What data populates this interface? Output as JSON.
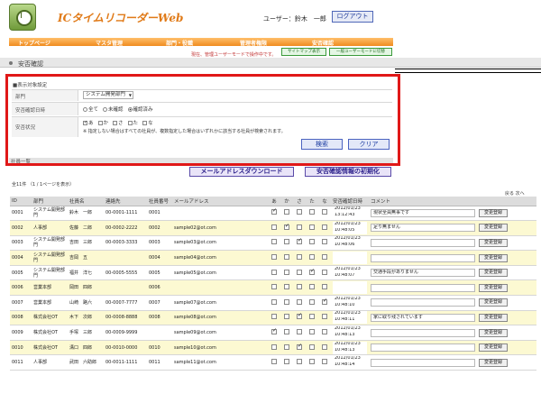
{
  "header": {
    "app_title": "ICタイムリコーダーWeb",
    "user_label": "ユーザー：鈴木　一郎",
    "logout": "ログアウト"
  },
  "nav": {
    "items": [
      "トップページ",
      "マスタ管理",
      "部門・役職",
      "管理者権限",
      "安否確認"
    ],
    "note": "現在、管理ユーザーモードで操作中です。",
    "sitemap_button": "サイトマップ表示",
    "user_mode_button": "一般ユーザーモードに切替"
  },
  "breadcrumb": "安否確認",
  "filter": {
    "title": "■表示対象設定",
    "dept_label": "部門",
    "dept_value": "システム開発部門",
    "reply_label": "安否確認日時",
    "reply_options": [
      {
        "label": "全て",
        "on": false
      },
      {
        "label": "未確認",
        "on": false
      },
      {
        "label": "確認済み",
        "on": true
      }
    ],
    "status_label": "安否状況",
    "status_options": [
      {
        "label": "あ",
        "on": true
      },
      {
        "label": "か",
        "on": false
      },
      {
        "label": "さ",
        "on": false
      },
      {
        "label": "た",
        "on": false
      },
      {
        "label": "な",
        "on": false
      }
    ],
    "note": "※ 指定しない場合はすべての社員が、複数指定した場合はいずれかに該当する社員が検索されます。",
    "search_button": "検索",
    "clear_button": "クリア"
  },
  "section_title": "社員一覧",
  "actions": {
    "download": "メールアドレスダウンロード",
    "reset": "安否確認情報の初期化"
  },
  "count_text": "全11件 （1 / 1ページを表示）",
  "pager": "戻る 次へ",
  "table": {
    "headers": [
      "ID",
      "部門",
      "社員名",
      "連絡先",
      "社員番号",
      "メールアドレス",
      "あ",
      "か",
      "さ",
      "た",
      "な",
      "安否確認日時",
      "コメント",
      ""
    ],
    "rows": [
      {
        "id": "0001",
        "dept": "システム開発部門",
        "name": "鈴木　一郎",
        "tel": "00-0001-1111",
        "num": "0001",
        "mail": "",
        "c": [
          true,
          false,
          false,
          false,
          false
        ],
        "date": "2012/01/23",
        "time": "13:12:43",
        "comment": "現状全員無事です",
        "btn": "変更登録"
      },
      {
        "id": "0002",
        "dept": "人事部",
        "name": "佐藤　二郎",
        "tel": "00-0002-2222",
        "num": "0002",
        "mail": "sample02@ot.com",
        "c": [
          false,
          true,
          false,
          false,
          false
        ],
        "date": "2012/01/23",
        "time": "10:48:05",
        "comment": "足り無ません",
        "btn": "変更登録"
      },
      {
        "id": "0003",
        "dept": "システム開発部門",
        "name": "吉田　三郎",
        "tel": "00-0003-3333",
        "num": "0003",
        "mail": "sample03@ot.com",
        "c": [
          false,
          false,
          true,
          false,
          false
        ],
        "date": "2012/01/23",
        "time": "10:48:06",
        "comment": "",
        "btn": "変更登録"
      },
      {
        "id": "0004",
        "dept": "システム開発部門",
        "name": "吉岡　五",
        "tel": "",
        "num": "0004",
        "mail": "sample04@ot.com",
        "c": [
          false,
          false,
          false,
          false,
          false
        ],
        "date": "",
        "time": "",
        "comment": "",
        "btn": "変更登録"
      },
      {
        "id": "0005",
        "dept": "システム開発部門",
        "name": "福井　洋七",
        "tel": "00-0005-5555",
        "num": "0005",
        "mail": "sample05@ot.com",
        "c": [
          false,
          false,
          false,
          true,
          false
        ],
        "date": "2012/01/23",
        "time": "10:48:07",
        "comment": "交通手段がありません",
        "btn": "変更登録"
      },
      {
        "id": "0006",
        "dept": "営業本部",
        "name": "岡田　四郎",
        "tel": "",
        "num": "0006",
        "mail": "",
        "c": [
          false,
          false,
          false,
          false,
          false
        ],
        "date": "",
        "time": "",
        "comment": "",
        "btn": "変更登録"
      },
      {
        "id": "0007",
        "dept": "営業本部",
        "name": "山崎　路六",
        "tel": "00-0007-7777",
        "num": "0007",
        "mail": "sample07@ot.com",
        "c": [
          false,
          false,
          false,
          false,
          true
        ],
        "date": "2012/01/23",
        "time": "10:48:10",
        "comment": "",
        "btn": "変更登録"
      },
      {
        "id": "0008",
        "dept": "株式会社OT",
        "name": "木下　次郎",
        "tel": "00-0008-8888",
        "num": "0008",
        "mail": "sample08@ot.com",
        "c": [
          false,
          false,
          true,
          false,
          false
        ],
        "date": "2012/01/23",
        "time": "10:48:11",
        "comment": "家に取り残されています",
        "btn": "変更登録"
      },
      {
        "id": "0009",
        "dept": "株式会社OT",
        "name": "手塚　三郎",
        "tel": "00-0009-9999",
        "num": "",
        "mail": "sample09@ot.com",
        "c": [
          true,
          false,
          false,
          false,
          false
        ],
        "date": "2012/01/23",
        "time": "10:48:13",
        "comment": "",
        "btn": "変更登録"
      },
      {
        "id": "0010",
        "dept": "株式会社OT",
        "name": "溝口　四郎",
        "tel": "00-0010-0000",
        "num": "0010",
        "mail": "sample10@ot.com",
        "c": [
          false,
          false,
          true,
          false,
          false
        ],
        "date": "2012/01/23",
        "time": "10:48:13",
        "comment": "",
        "btn": "変更登録"
      },
      {
        "id": "0011",
        "dept": "人事部",
        "name": "武田　六助郎",
        "tel": "00-0011-1111",
        "num": "0011",
        "mail": "sample11@ot.com",
        "c": [
          false,
          false,
          false,
          false,
          false
        ],
        "date": "2012/01/23",
        "time": "10:48:14",
        "comment": "",
        "btn": "変更登録"
      }
    ]
  }
}
